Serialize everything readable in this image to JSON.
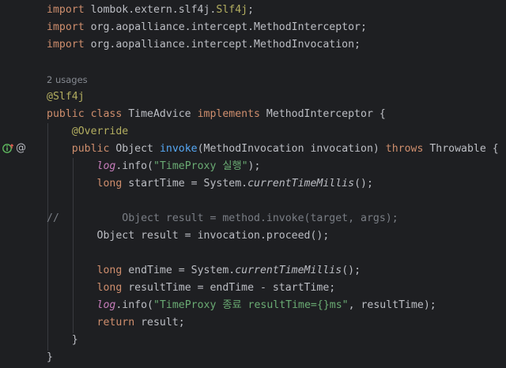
{
  "colors": {
    "background": "#1e1f22",
    "keyword": "#cf8e6d",
    "annotation": "#b3ae60",
    "method": "#56a8f5",
    "string": "#6aab73",
    "field": "#c77dbb",
    "comment": "#7a7e85",
    "default_text": "#bcbec4"
  },
  "gutter": {
    "icons": [
      "implementation-marker-icon",
      "override-annotation-icon"
    ]
  },
  "code": {
    "import1": {
      "kw": "import",
      "path": " lombok.extern.slf4j.",
      "cls": "Slf4j",
      "end": ";"
    },
    "import2": {
      "kw": "import",
      "rest": " org.aopalliance.intercept.MethodInterceptor;"
    },
    "import3": {
      "kw": "import",
      "rest": " org.aopalliance.intercept.MethodInvocation;"
    },
    "usages": "2 usages",
    "slf4j_ann": "@Slf4j",
    "class_decl": {
      "kw1": "public",
      "kw2": " class",
      "name": " TimeAdvice ",
      "kw3": "implements",
      "rest": " MethodInterceptor {"
    },
    "override": "@Override",
    "method_decl": {
      "kw": "public",
      "ret": " Object ",
      "name": "invoke",
      "params": "(MethodInvocation invocation) ",
      "kw2": "throws",
      "rest": " Throwable {"
    },
    "log1": {
      "field": "log",
      "call": ".info(",
      "str": "\"TimeProxy 실행\"",
      "end": ");"
    },
    "start_time": {
      "kw": "long",
      "mid": " startTime = System.",
      "method": "currentTimeMillis",
      "end": "();"
    },
    "comment_slashes": "//",
    "comment_body": "Object result = method.invoke(target, args);",
    "proceed": "Object result = invocation.proceed();",
    "end_time": {
      "kw": "long",
      "mid": " endTime = System.",
      "method": "currentTimeMillis",
      "end": "();"
    },
    "result_time": {
      "kw": "long",
      "rest": " resultTime = endTime - startTime;"
    },
    "log2": {
      "field": "log",
      "call": ".info(",
      "str": "\"TimeProxy 종료 resultTime={}ms\"",
      "end": ", resultTime);"
    },
    "return_stmt": {
      "kw": "return",
      "rest": " result;"
    },
    "close_method": "}",
    "close_class": "}"
  }
}
